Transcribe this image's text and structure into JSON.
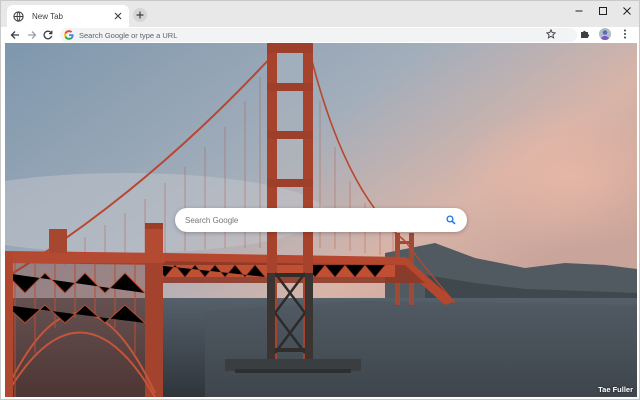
{
  "tab": {
    "title": "New Tab"
  },
  "omnibox": {
    "placeholder": "Search Google or type a URL"
  },
  "ntp": {
    "search_placeholder": "Search Google",
    "photo_credit": "Tae Fuller"
  },
  "icons": {
    "tab_favicon": "globe-icon",
    "tab_close": "close-icon",
    "new_tab": "plus-icon",
    "back": "back-arrow-icon",
    "forward": "forward-arrow-icon",
    "reload": "reload-icon",
    "omnibox_google": "google-g-icon",
    "bookmark": "star-icon",
    "extensions": "puzzle-icon",
    "profile": "avatar",
    "menu": "kebab-menu-icon",
    "search": "search-icon"
  },
  "colors": {
    "tabstrip": "#e8e8e8",
    "omnibox_bg": "#f1f3f4",
    "google_blue": "#1a73e8",
    "bridge_red": "#c0472d"
  }
}
